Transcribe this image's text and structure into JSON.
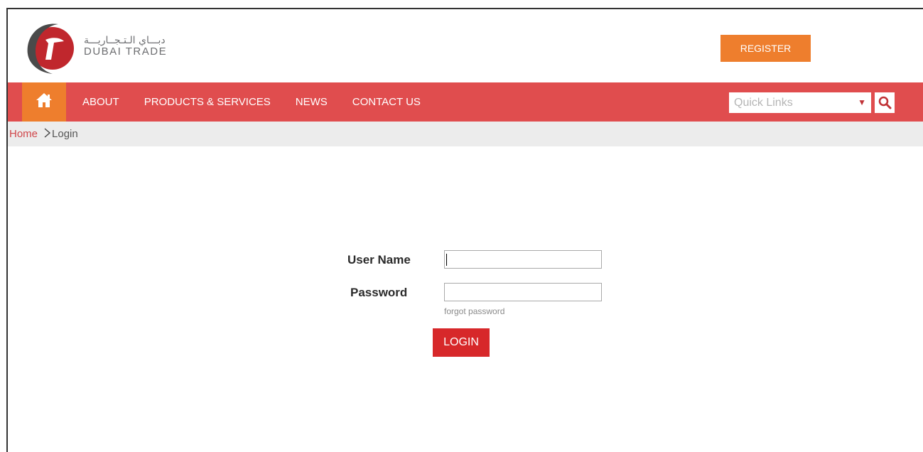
{
  "header": {
    "logo_arabic": "دبـــاي الـتـجــاريـــة",
    "logo_english": "DUBAI TRADE",
    "register_label": "REGISTER"
  },
  "nav": {
    "home_icon": "home-icon",
    "items": [
      {
        "label": "ABOUT"
      },
      {
        "label": "PRODUCTS & SERVICES"
      },
      {
        "label": "NEWS"
      },
      {
        "label": "CONTACT US"
      }
    ],
    "quick_links": {
      "placeholder": "Quick Links",
      "caret": "▼"
    },
    "search_icon": "search-icon"
  },
  "breadcrumb": {
    "home": "Home",
    "separator_icon": "chevron-right-icon",
    "current": "Login"
  },
  "login_form": {
    "username_label": "User Name",
    "username_value": "",
    "password_label": "Password",
    "password_value": "",
    "forgot_link": "forgot password",
    "login_button": "LOGIN"
  },
  "colors": {
    "nav_red": "#e04d4e",
    "accent_orange": "#ee7e2d",
    "login_red": "#d7282a",
    "breadcrumb_bg": "#ececec"
  }
}
